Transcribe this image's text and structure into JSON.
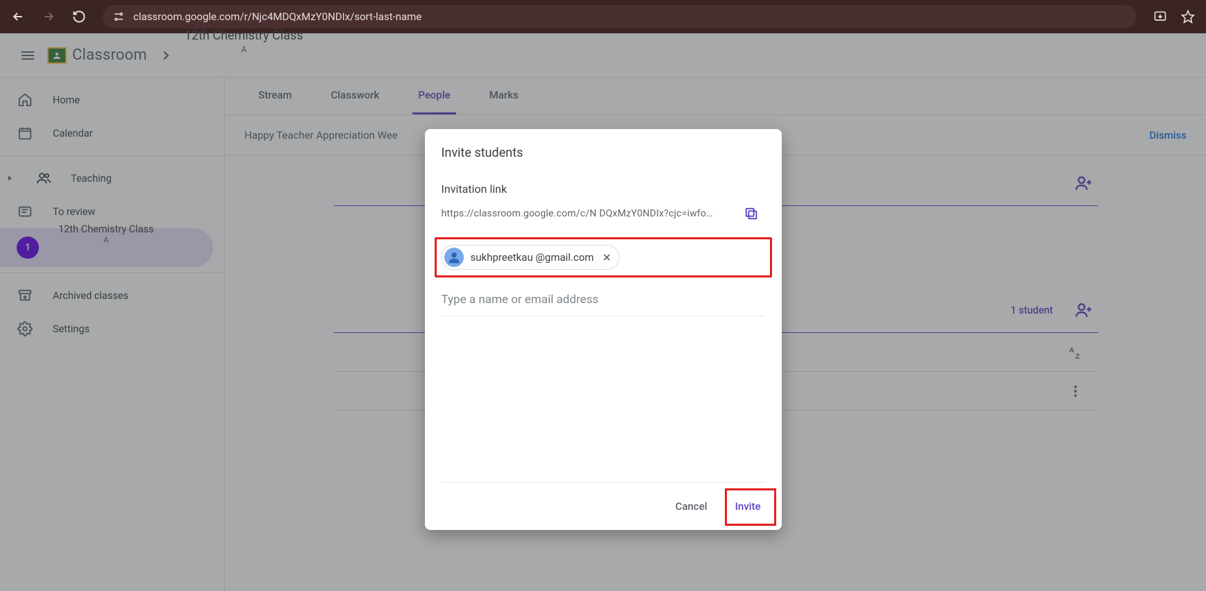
{
  "browser": {
    "url": "classroom.google.com/r/Njc4MDQxMzY0NDIx/sort-last-name"
  },
  "header": {
    "app_name": "Classroom",
    "class_name": "12th Chemistry Class",
    "class_section": "A"
  },
  "sidebar": {
    "home": "Home",
    "calendar": "Calendar",
    "teaching": "Teaching",
    "to_review": "To review",
    "class_badge": "1",
    "class_name": "12th Chemistry Class",
    "class_section": "A",
    "archived": "Archived classes",
    "settings": "Settings"
  },
  "tabs": {
    "stream": "Stream",
    "classwork": "Classwork",
    "people": "People",
    "marks": "Marks"
  },
  "banner": {
    "text": "Happy Teacher Appreciation Wee",
    "dismiss": "Dismiss"
  },
  "sections": {
    "students_count": "1 student"
  },
  "dialog": {
    "title": "Invite students",
    "link_label": "Invitation link",
    "link_url": "https://classroom.google.com/c/N     DQxMzY0NDIx?cjc=iwfo…",
    "chip_email": "sukhpreetkau       @gmail.com",
    "placeholder": "Type a name or email address",
    "cancel": "Cancel",
    "invite": "Invite"
  }
}
